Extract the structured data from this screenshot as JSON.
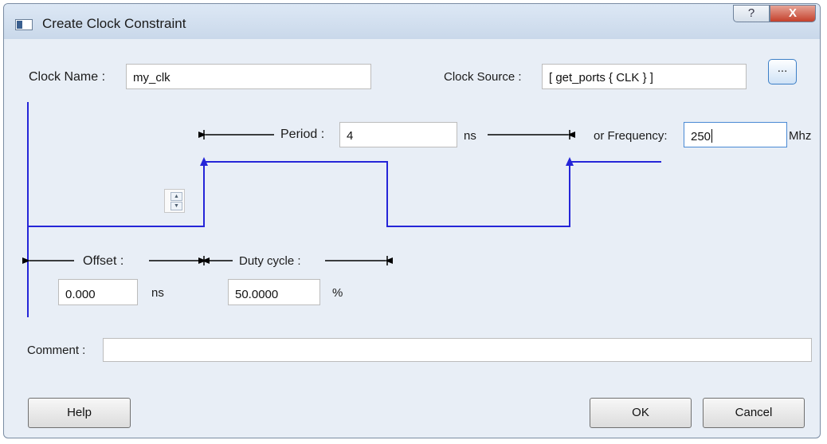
{
  "window": {
    "title": "Create Clock Constraint",
    "help_glyph": "?",
    "close_glyph": "X"
  },
  "clock_name": {
    "label": "Clock Name :",
    "value": "my_clk"
  },
  "clock_source": {
    "label": "Clock Source :",
    "value": "[ get_ports { CLK } ]",
    "browse_label": "..."
  },
  "period": {
    "label": "Period :",
    "value": "4",
    "unit": "ns"
  },
  "frequency": {
    "label": "or Frequency:",
    "value": "250",
    "unit": "Mhz"
  },
  "offset": {
    "label": "Offset :",
    "value": "0.000",
    "unit": "ns"
  },
  "duty_cycle": {
    "label": "Duty cycle :",
    "value": "50.0000",
    "unit": "%"
  },
  "comment": {
    "label": "Comment :",
    "value": ""
  },
  "spinner": {
    "up_glyph": "▲",
    "down_glyph": "▼"
  },
  "buttons": {
    "help": "Help",
    "ok": "OK",
    "cancel": "Cancel"
  },
  "colors": {
    "waveform": "#2525d8",
    "arrow": "#000000"
  }
}
